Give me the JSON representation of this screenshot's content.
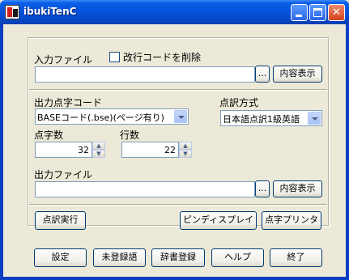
{
  "window": {
    "title": "ibukiTenC"
  },
  "input_section": {
    "label": "入力ファイル",
    "checkbox_label": "改行コードを削除",
    "checkbox_checked": false,
    "file_value": "",
    "browse_label": "...",
    "view_label": "内容表示"
  },
  "output_braille_code": {
    "label": "出力点字コード",
    "selected": "BASEコード(.bse)(ページ有り)"
  },
  "braille_method": {
    "label": "点訳方式",
    "selected": "日本語点訳1級英語"
  },
  "chars_per_line": {
    "label": "点字数",
    "value": "32"
  },
  "lines_per_page": {
    "label": "行数",
    "value": "22"
  },
  "output_section": {
    "label": "出力ファイル",
    "file_value": "",
    "browse_label": "...",
    "view_label": "内容表示"
  },
  "actions": {
    "execute_label": "点訳実行",
    "pin_display_label": "ピンディスプレイ",
    "printer_label": "点字プリンタ"
  },
  "footer": {
    "settings_label": "設定",
    "unregistered_label": "未登録語",
    "dictionary_label": "辞書登録",
    "help_label": "ヘルプ",
    "exit_label": "終了"
  },
  "colors": {
    "title_bar": "#0653dc",
    "client_bg": "#ece9d8",
    "button_border": "#003c74"
  }
}
